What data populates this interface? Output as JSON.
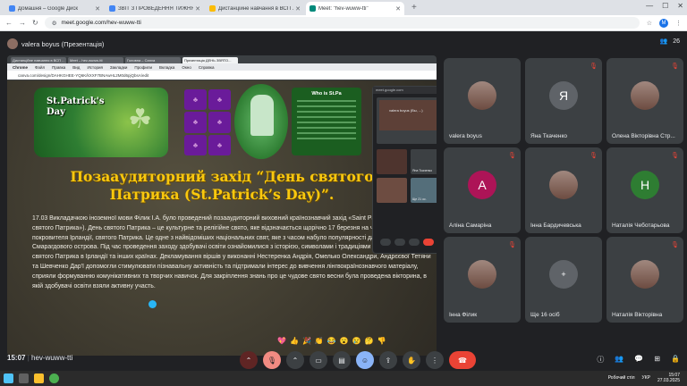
{
  "browser": {
    "tabs": [
      {
        "title": "Домашня – Google Диск",
        "color": "#4285f4",
        "active": false
      },
      {
        "title": "ЗВІТ З ПРОВЕДЕННЯ ТИЖНЯ ...",
        "color": "#4285f4",
        "active": false
      },
      {
        "title": "Дистанційне навчання в ВСП ...",
        "color": "#fbbc04",
        "active": false
      },
      {
        "title": "Meet: \"hev-wuww-tti\"",
        "color": "#00897b",
        "active": true
      }
    ],
    "url": "meet.google.com/hev-wuww-tti",
    "profile_initial": "M"
  },
  "meeting": {
    "presenter_label": "valera boyus (Презентація)",
    "participant_count": "26",
    "time": "15:07",
    "code": "hev-wuww-tti"
  },
  "shared_screen": {
    "inner_tabs": [
      "Дистанційне навчання в ВСП ...",
      "Meet – hev-wuww-tti",
      "Головна – Canva",
      "Презентація ДЕНЬ ЗВЯТО..."
    ],
    "inner_menu": [
      "Chrome",
      "Файл",
      "Правка",
      "Вид",
      "История",
      "Закладки",
      "Профили",
      "Вкладка",
      "Окно",
      "Справка"
    ],
    "inner_url": "canva.com/design/DAHKGHEE-YQ6K/kXXF7BNAwHL2M0d6pjQbsA/edit",
    "slide": {
      "card_title": "St.Patrick's\nDay",
      "info_title": "Who is St.Pa",
      "heading": "Позааудиторний захід “День святого Патрика (St.Patrick’s Day)”.",
      "body": "17.03 Викладачкою іноземної мови Філик І.А. було проведений позааудиторний виховний країнознавчий захід «Saint Patrick's Day» («День святого Патрика»). День святого Патрика – це культурне та релігійне свято, яке відзначається щорічно 17 березня на честь небесного покровителя Ірландії, святого Патрика. Це одне з найвідоміших національних свят, яке з часом набуло популярності далеко за межами Смарагдового острова. Під час проведення заходу здобувачі освіти ознайомилися з історією, символами і традиціями святкування Дня святого Патрика в Ірландії та інших країнах. Декламування віршів у виконанні Нестеренка Андрія, Омелько Олександри, Андрєєвої Тетяни та Шевченко Дар'ї допомогли стимулювати пізнавальну активність та підтримали інтерес до вивчення лінгвокраїнознавчого матеріалу, сприяли формуванню комунікативних та творчих навичок. Для закріплення знань про це чудове свято весни була проведена вікторина, в якій здобувачі освіти взяли активну участь."
    },
    "mini_meet": {
      "title": "meet.google.com",
      "label": "valera boyus (Вы, ...)",
      "tile_names": [
        "Яна Ткаченко",
        "Ще 21 ос."
      ]
    }
  },
  "participants": [
    {
      "name": "valera boyus",
      "type": "photo",
      "muted": false
    },
    {
      "name": "Яна Ткаченко",
      "type": "initial",
      "initial": "Я",
      "color": "#5f6368",
      "muted": true
    },
    {
      "name": "Олена Вікторівна Стр...",
      "type": "photo",
      "muted": true
    },
    {
      "name": "Аліна Самаріна",
      "type": "initial",
      "initial": "А",
      "color": "#ad1457",
      "muted": true
    },
    {
      "name": "Інна Бардичевська",
      "type": "photo",
      "muted": true
    },
    {
      "name": "Наталія Чеботарьова",
      "type": "initial",
      "initial": "Н",
      "color": "#2e7d32",
      "muted": true
    },
    {
      "name": "Інна Філик",
      "type": "photo",
      "muted": true
    },
    {
      "name": "Ще 16 осіб",
      "type": "more",
      "muted": false
    },
    {
      "name": "Наталія Вікторівна",
      "type": "photo",
      "muted": true
    }
  ],
  "reactions": [
    "💖",
    "👍",
    "🎉",
    "👏",
    "😂",
    "😮",
    "😢",
    "🤔",
    "👎"
  ],
  "taskbar": {
    "workspace": "Робочий стіл",
    "clock_time": "15:07",
    "clock_date": "27.03.2025",
    "lang": "УКР"
  }
}
